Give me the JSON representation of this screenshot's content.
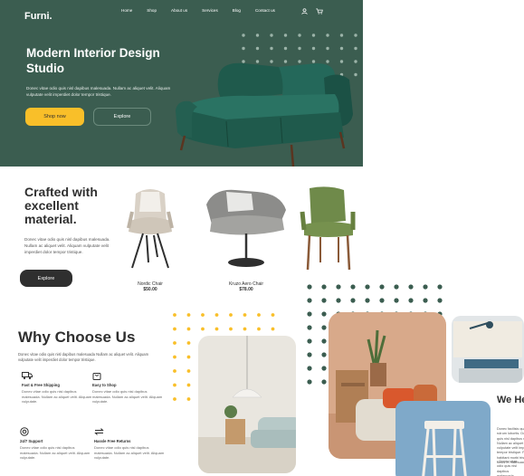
{
  "header": {
    "logo": "Furni.",
    "nav": [
      "Home",
      "Shop",
      "About us",
      "Services",
      "Blog",
      "Contact us"
    ],
    "icons": [
      "user-icon",
      "cart-icon"
    ]
  },
  "hero": {
    "title": "Modern Interior Design Studio",
    "description": "Donec vitae odio quis nisl dapibus malesuada. Nullam ac aliquet velit. Aliquam vulputate velit imperdiet dolor tempor tristique.",
    "primary_button": "Shop now",
    "secondary_button": "Explore"
  },
  "crafted": {
    "title": "Crafted with excellent material.",
    "description": "Donec vitae odio quis nisl dapibus malesuada. Nullam ac aliquet velit. Aliquam vulputate velit imperdiet dolor tempor tristique.",
    "button": "Explore",
    "products": [
      {
        "name": "Nordic Chair",
        "price": "$50.00"
      },
      {
        "name": "Kruzo Aero Chair",
        "price": "$78.00"
      }
    ]
  },
  "why": {
    "title": "Why Choose Us",
    "description": "Donec vitae odio quis nisl dapibus malesuada Nullam ac aliquet velit. Aliquam vulputate velit imperdiet dolor tempor tristique.",
    "features": [
      {
        "icon": "truck-icon",
        "title": "Fast & Free Shipping",
        "text": "Donec vitae odio quis nisl dapibus malesuada. Nullam ac aliquet velit. Aliquam vulputate."
      },
      {
        "icon": "bag-icon",
        "title": "Easy to Shop",
        "text": "Donec vitae odio quis nisl dapibus malesuada. Nullam ac aliquet velit. Aliquam vulputate."
      },
      {
        "icon": "support-icon",
        "title": "24/7 Support",
        "text": "Donec vitae odio quis nisl dapibus malesuada. Nullam ac aliquet velit. Aliquam vulputate."
      },
      {
        "icon": "return-icon",
        "title": "Hassle Free Returns",
        "text": "Donec vitae odio quis nisl dapibus malesuada. Nullam ac aliquet velit. Aliquam vulputate."
      }
    ]
  },
  "interior": {
    "title": "We Help You Make Modern Interior Design",
    "description": "Donec facilisis quam ut purus rutrum lobortis. Donec vitae odio quis nisl dapibus malesuada. Nullam ac aliquet velit. Aliquam vulputate velit imperdiet dolor tempor tristique. Pellentesque habitant morbi tristique senectus et netus et malesuada",
    "list": [
      "Donec vitae odio quis nisl dapibus malesuada"
    ]
  },
  "colors": {
    "hero_bg": "#3b5d50",
    "accent": "#f9bf29",
    "dark": "#2f2f2f"
  }
}
